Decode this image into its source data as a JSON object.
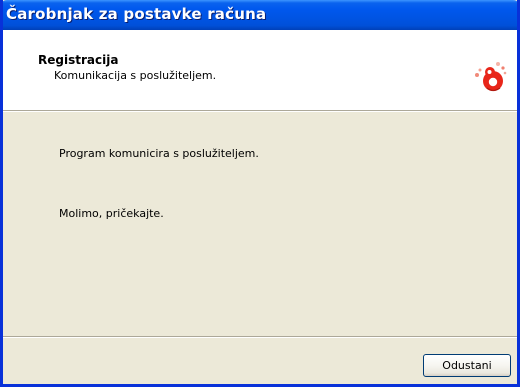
{
  "window": {
    "title": "Čarobnjak za postavke računa"
  },
  "header": {
    "title": "Registracija",
    "subtitle": "Komunikacija s poslužiteljem."
  },
  "body": {
    "line1": "Program komunicira s poslužiteljem.",
    "line2": "Molimo, pričekajte."
  },
  "footer": {
    "cancel_label": "Odustani"
  },
  "icons": {
    "logo": "logo-icon"
  },
  "colors": {
    "titlebar": "#0054e3",
    "accent": "#e8261a",
    "window_bg": "#ece9d8"
  }
}
